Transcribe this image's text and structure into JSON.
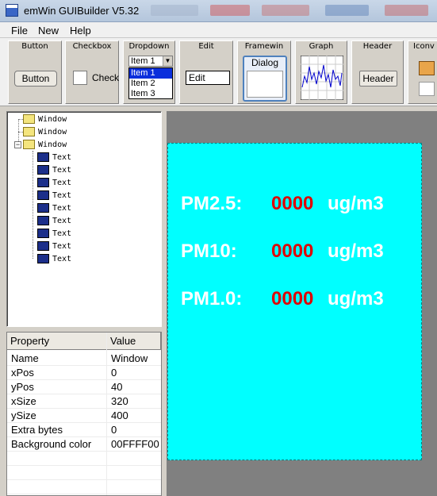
{
  "window": {
    "title": "emWin GUIBuilder V5.32"
  },
  "menu": [
    "File",
    "New",
    "Help"
  ],
  "toolbar": {
    "button": {
      "title": "Button",
      "widget_label": "Button"
    },
    "checkbox": {
      "title": "Checkbox",
      "widget_label": "Check"
    },
    "dropdown": {
      "title": "Dropdown",
      "selected": "Item 1",
      "items": [
        "Item 1",
        "Item 2",
        "Item 3"
      ]
    },
    "edit": {
      "title": "Edit",
      "widget_label": "Edit"
    },
    "framewin": {
      "title": "Framewin",
      "widget_label": "Dialog"
    },
    "graph": {
      "title": "Graph"
    },
    "header": {
      "title": "Header",
      "widget_label": "Header"
    },
    "icon": {
      "title": "Iconv"
    }
  },
  "tree": {
    "nodes": [
      "Window",
      "Window",
      "Window",
      "Text",
      "Text",
      "Text",
      "Text",
      "Text",
      "Text",
      "Text",
      "Text",
      "Text"
    ]
  },
  "properties": {
    "headers": [
      "Property",
      "Value"
    ],
    "rows": [
      {
        "name": "Name",
        "value": "Window"
      },
      {
        "name": "xPos",
        "value": "0"
      },
      {
        "name": "yPos",
        "value": "40"
      },
      {
        "name": "xSize",
        "value": "320"
      },
      {
        "name": "ySize",
        "value": "400"
      },
      {
        "name": "Extra bytes",
        "value": "0"
      },
      {
        "name": "Background color",
        "value": "00FFFF00"
      }
    ]
  },
  "preview": {
    "background_color": "#00FFFF",
    "readings": [
      {
        "label": "PM2.5:",
        "value": "0000",
        "unit": "ug/m3"
      },
      {
        "label": "PM10:",
        "value": "0000",
        "unit": "ug/m3"
      },
      {
        "label": "PM1.0:",
        "value": "0000",
        "unit": "ug/m3"
      }
    ]
  }
}
